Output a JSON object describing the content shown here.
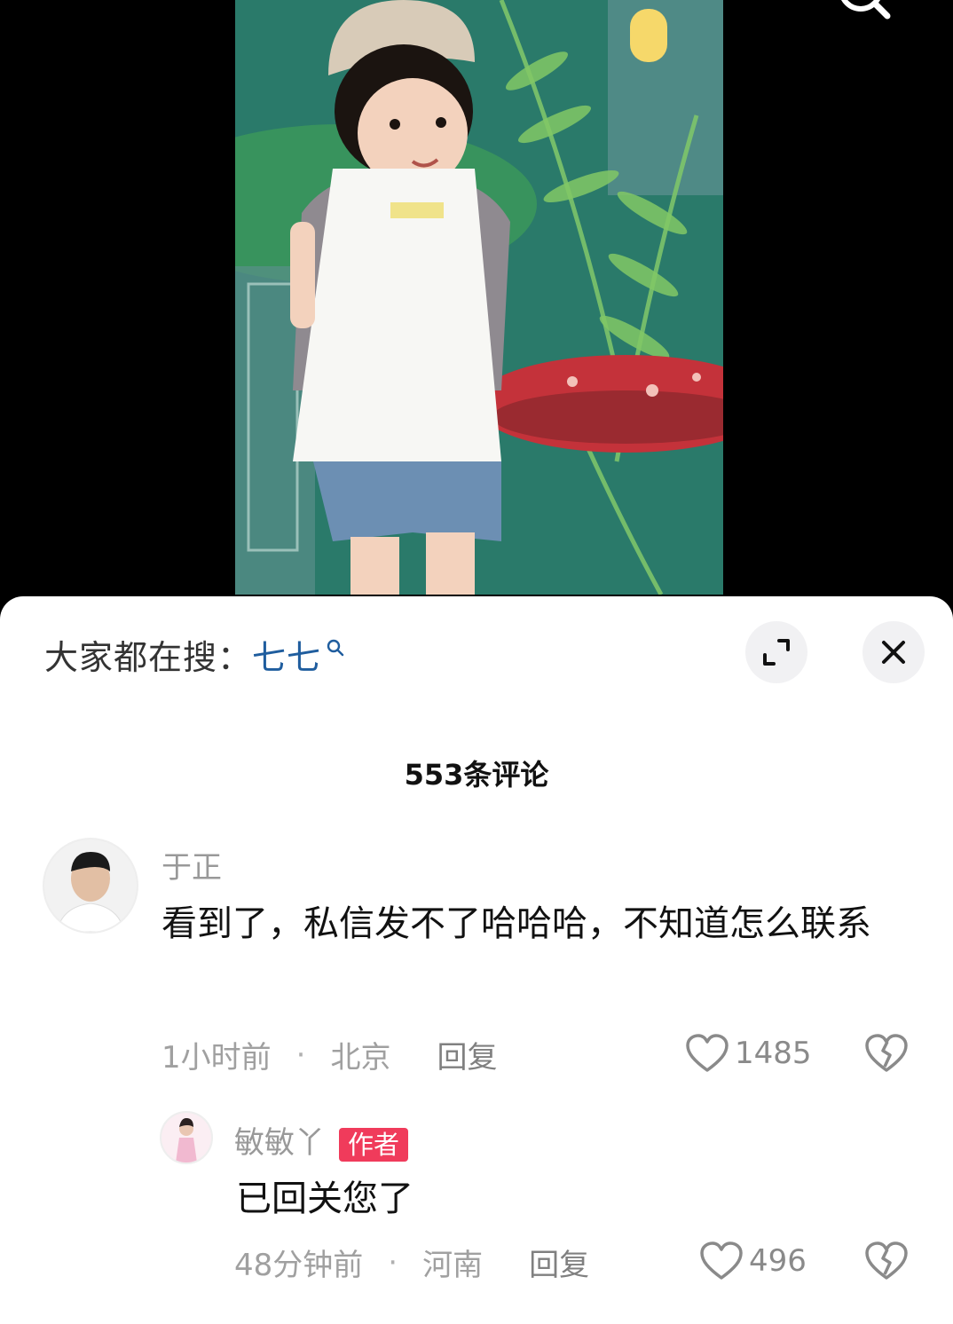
{
  "search_bar": {
    "prefix": "大家都在搜：",
    "term": "七七"
  },
  "comments_header": {
    "title": "553条评论"
  },
  "comments": [
    {
      "username": "于正",
      "text": "看到了，私信发不了哈哈哈，不知道怎么联系",
      "time": "1小时前",
      "location": "北京",
      "reply_label": "回复",
      "likes": "1485"
    }
  ],
  "reply": {
    "username": "敏敏丫",
    "badge": "作者",
    "text": "已回关您了",
    "time": "48分钟前",
    "location": "河南",
    "reply_label": "回复",
    "likes": "496"
  },
  "colors": {
    "accent_link": "#1f5d9e",
    "author_badge": "#f03b5b",
    "sheet_background": "#ffffff",
    "video_background": "#000000"
  },
  "icons": [
    "search-icon",
    "expand-icon",
    "close-icon",
    "heart-icon",
    "broken-heart-icon"
  ]
}
